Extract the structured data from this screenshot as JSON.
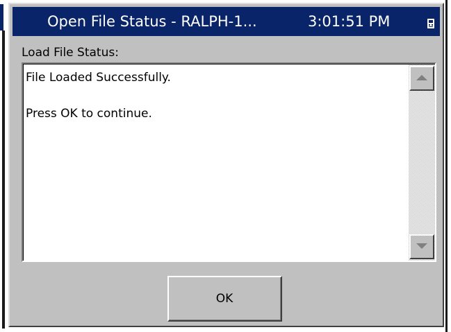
{
  "window": {
    "title": "Open File Status - RALPH-1...",
    "clock": "3:01:51 PM",
    "system_icon": "device-icon"
  },
  "status": {
    "label": "Load File Status:",
    "lines": [
      "File Loaded Successfully.",
      "",
      "Press OK to continue."
    ]
  },
  "scrollbar": {
    "up_icon": "scroll-up-arrow-icon",
    "down_icon": "scroll-down-arrow-icon"
  },
  "buttons": {
    "ok_label": "OK"
  },
  "colors": {
    "titlebar": "#0a246a",
    "dialog_face": "#c0c0c0",
    "text_bg": "#ffffff"
  }
}
